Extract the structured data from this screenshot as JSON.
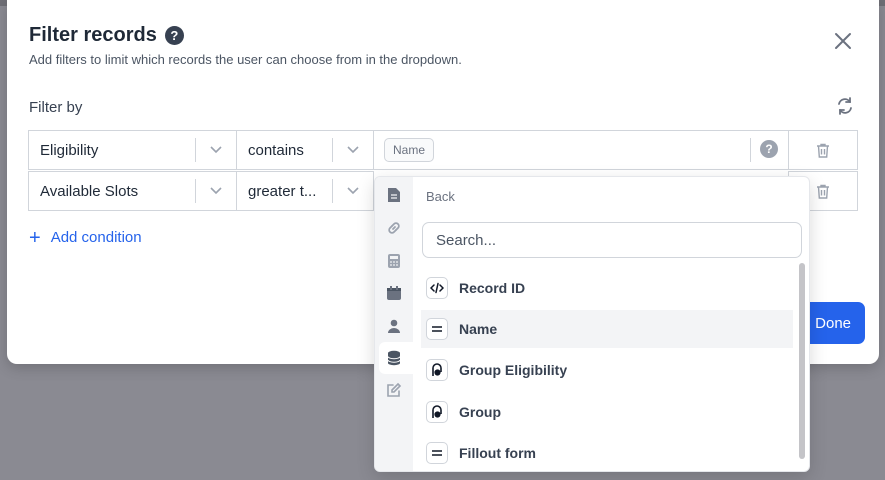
{
  "modal": {
    "title": "Filter records",
    "subtitle": "Add filters to limit which records the user can choose from in the dropdown.",
    "filter_by_label": "Filter by",
    "add_condition_label": "Add condition",
    "done_label": "Done"
  },
  "conditions": [
    {
      "field": "Eligibility",
      "operator": "contains",
      "value_chip": "Name"
    },
    {
      "field": "Available Slots",
      "operator": "greater t..."
    }
  ],
  "dropdown": {
    "back_label": "Back",
    "search_placeholder": "Search...",
    "rail_icons": [
      "document-icon",
      "link-icon",
      "calculator-icon",
      "calendar-icon",
      "person-icon",
      "database-icon",
      "edit-icon"
    ],
    "active_rail": "database-icon",
    "items": [
      {
        "label": "Record ID",
        "icon": "code-icon"
      },
      {
        "label": "Name",
        "icon": "equals-icon",
        "highlighted": true
      },
      {
        "label": "Group Eligibility",
        "icon": "linked-record-icon"
      },
      {
        "label": "Group",
        "icon": "linked-record-icon"
      },
      {
        "label": "Fillout form",
        "icon": "equals-icon"
      }
    ]
  },
  "colors": {
    "accent": "#2563eb",
    "backdrop": "#8a8a92"
  }
}
